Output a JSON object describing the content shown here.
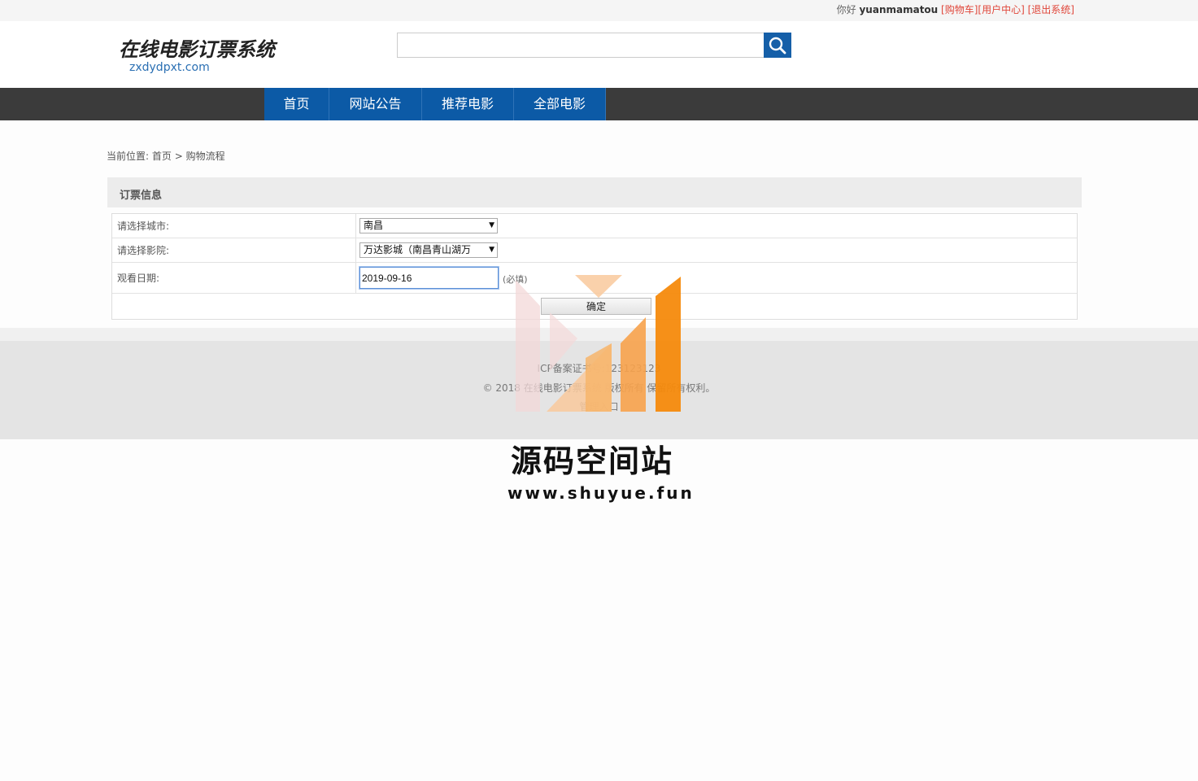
{
  "topbar": {
    "greeting": "你好",
    "username": "yuanmamatou",
    "cart_link": "[购物车]",
    "user_center_link": "[用户中心]",
    "logout_link": "[退出系统]"
  },
  "header": {
    "logo_cn": "在线电影订票系统",
    "logo_en": "zxdydpxt.com",
    "search": {
      "value": "",
      "button_icon": "search-icon"
    }
  },
  "nav": {
    "items": [
      "首页",
      "网站公告",
      "推荐电影",
      "全部电影"
    ]
  },
  "breadcrumb": {
    "prefix": "当前位置:",
    "home": "首页",
    "separator": ">",
    "current": "购物流程"
  },
  "panel": {
    "title": "订票信息"
  },
  "form": {
    "city_label": "请选择城市:",
    "city_value": "南昌",
    "cinema_label": "请选择影院:",
    "cinema_value": "万达影城（南昌青山湖万",
    "date_label": "观看日期:",
    "date_value": "2019-09-16",
    "required_note": "(必填)",
    "submit_label": "确定"
  },
  "footer": {
    "line1": "ICP备案证书号:123123123",
    "line2": "© 2018 在线电影订票系统 版权所有 保留所有权利。",
    "line3": "管理入口"
  },
  "watermark": {
    "title": "源码空间站",
    "url": "www.shuyue.fun",
    "colors": {
      "light": "#f9c99c",
      "mid": "#f7a24b",
      "dark": "#f58a0c",
      "pink": "#f3d8d8"
    }
  }
}
